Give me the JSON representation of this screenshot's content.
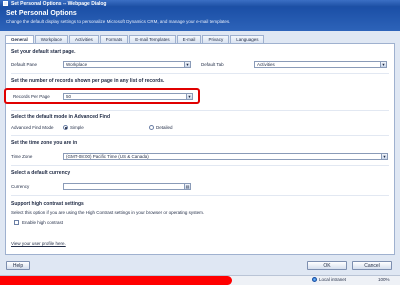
{
  "window": {
    "title": "Set Personal Options -- Webpage Dialog"
  },
  "header": {
    "title": "Set Personal Options",
    "description": "Change the default display settings to personalize Microsoft Dynamics CRM, and manage your e-mail templates."
  },
  "tabs": [
    {
      "label": "General",
      "active": true
    },
    {
      "label": "Workplace"
    },
    {
      "label": "Activities"
    },
    {
      "label": "Formats"
    },
    {
      "label": "E-mail Templates"
    },
    {
      "label": "E-mail"
    },
    {
      "label": "Privacy"
    },
    {
      "label": "Languages"
    }
  ],
  "start_page": {
    "heading": "Set your default start page.",
    "pane_label": "Default Pane",
    "pane_value": "Workplace",
    "tab_label": "Default Tab",
    "tab_value": "Activities"
  },
  "records": {
    "heading": "Set the number of records shown per page in any list of records.",
    "label": "Records Per Page",
    "value": "50"
  },
  "advanced_find": {
    "heading": "Select the default mode in Advanced Find",
    "label": "Advanced Find Mode",
    "option_simple": "Simple",
    "option_detailed": "Detailed",
    "selected": "Simple"
  },
  "timezone": {
    "heading": "Set the time zone you are in",
    "label": "Time Zone",
    "value": "(GMT-08:00) Pacific Time (US & Canada)"
  },
  "currency": {
    "heading": "Select a default currency",
    "label": "Currency",
    "value": ""
  },
  "contrast": {
    "heading": "Support high contrast settings",
    "description": "Select this option if you are using the High Contrast settings in your browser or operating system.",
    "checkbox_label": "Enable high contrast",
    "checked": false
  },
  "profile_link": "View your user profile here.",
  "buttons": {
    "help": "Help",
    "ok": "OK",
    "cancel": "Cancel"
  },
  "status": {
    "zone": "Local intranet",
    "zoom": "100%"
  },
  "colors": {
    "header_blue": "#1b4fa6",
    "highlight_red": "#e00000"
  }
}
